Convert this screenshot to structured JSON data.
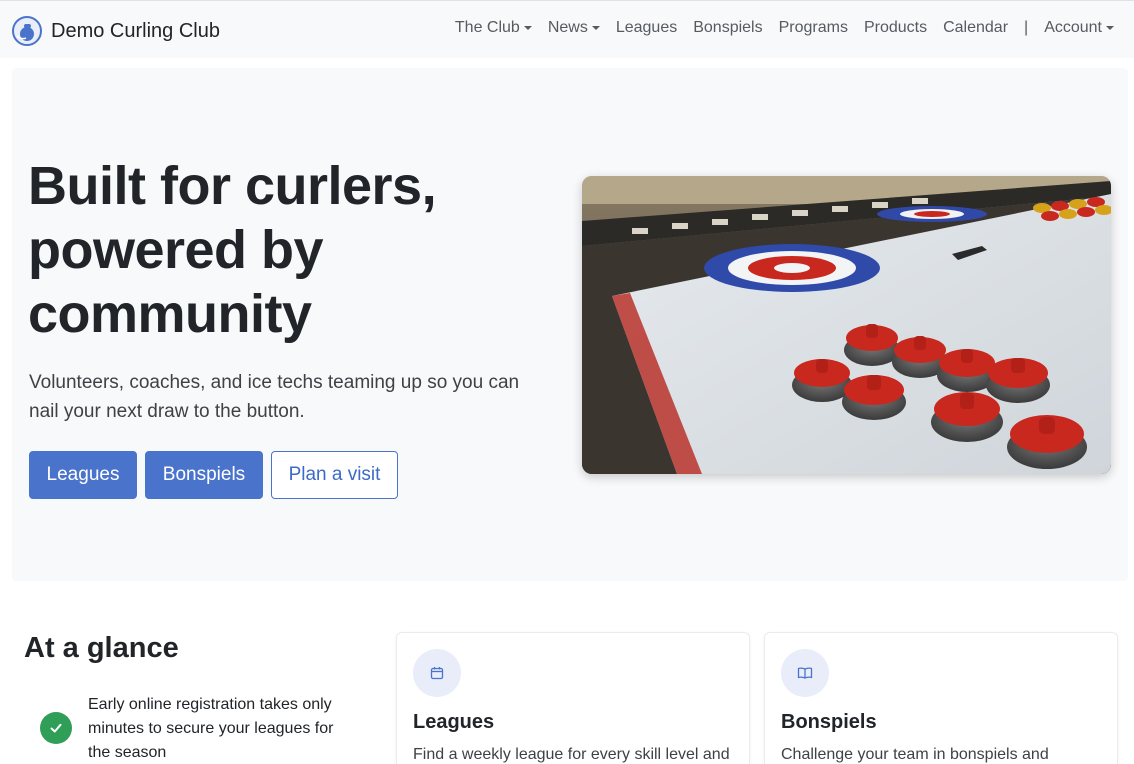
{
  "brand": {
    "name": "Demo Curling Club",
    "logo_icon": "curling-stone-logo-icon"
  },
  "nav": {
    "items": [
      {
        "label": "The Club",
        "dropdown": true
      },
      {
        "label": "News",
        "dropdown": true
      },
      {
        "label": "Leagues",
        "dropdown": false
      },
      {
        "label": "Bonspiels",
        "dropdown": false
      },
      {
        "label": "Programs",
        "dropdown": false
      },
      {
        "label": "Products",
        "dropdown": false
      },
      {
        "label": "Calendar",
        "dropdown": false
      }
    ],
    "divider": "|",
    "account": {
      "label": "Account",
      "dropdown": true
    }
  },
  "hero": {
    "title": "Built for curlers, powered by community",
    "lead": "Volunteers, coaches, and ice techs teaming up so you can nail your next draw to the button.",
    "buttons": {
      "leagues": "Leagues",
      "bonspiels": "Bonspiels",
      "visit": "Plan a visit"
    },
    "image": "curling-rink-stones-photo"
  },
  "glance": {
    "title": "At a glance",
    "item_text": "Early online registration takes only minutes to secure your leagues for the season",
    "item_icon": "check-icon"
  },
  "cards": [
    {
      "title": "Leagues",
      "text": "Find a weekly league for every skill level and",
      "icon": "calendar-icon"
    },
    {
      "title": "Bonspiels",
      "text": "Challenge your team in bonspiels and",
      "icon": "book-open-icon"
    }
  ],
  "colors": {
    "primary": "#4a74cc",
    "success": "#2f9e57",
    "hero_bg": "#f8f9fa",
    "stone_red": "#c8281e"
  }
}
